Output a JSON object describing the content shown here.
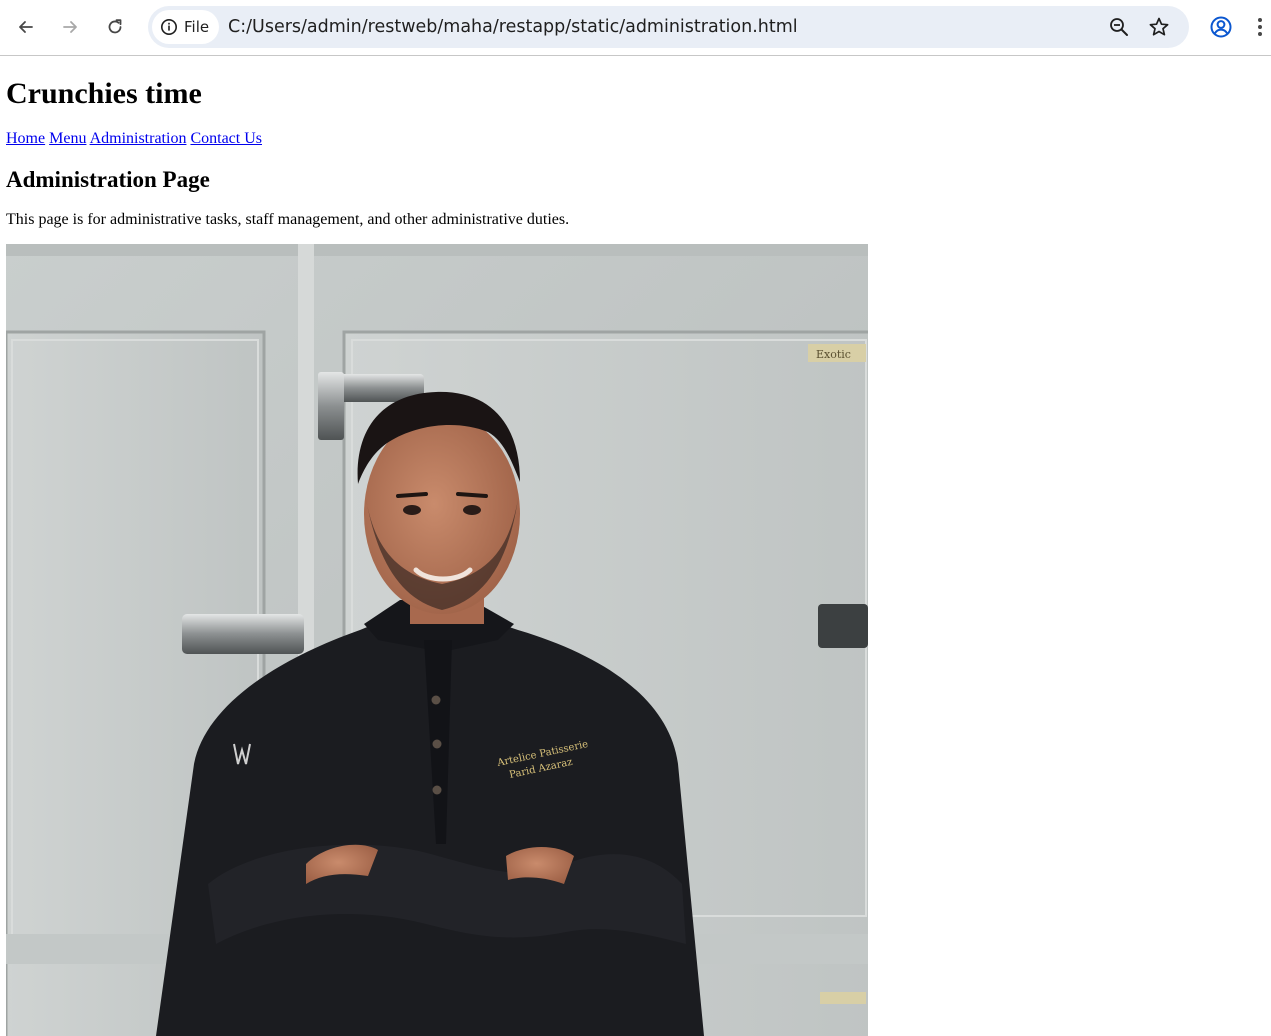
{
  "browser": {
    "site_chip_label": "File",
    "url": "C:/Users/admin/restweb/maha/restapp/static/administration.html",
    "accent_color": "#0b57d0",
    "icons": [
      "back-arrow-icon",
      "forward-arrow-icon",
      "reload-icon",
      "info-icon",
      "zoom-out-icon",
      "star-icon",
      "profile-icon",
      "menu-dots-icon"
    ]
  },
  "page": {
    "site_title": "Crunchies time",
    "nav": [
      {
        "label": "Home"
      },
      {
        "label": "Menu"
      },
      {
        "label": "Administration"
      },
      {
        "label": "Contact Us"
      }
    ],
    "heading": "Administration Page",
    "description": "This page is for administrative tasks, staff management, and other administrative duties.",
    "photo": {
      "door_label": "Exotic",
      "shirt_embroidery_line1": "Artelice Patisserie",
      "shirt_embroidery_line2": "Parid Azaraz"
    },
    "link_color": "#0000ee"
  }
}
